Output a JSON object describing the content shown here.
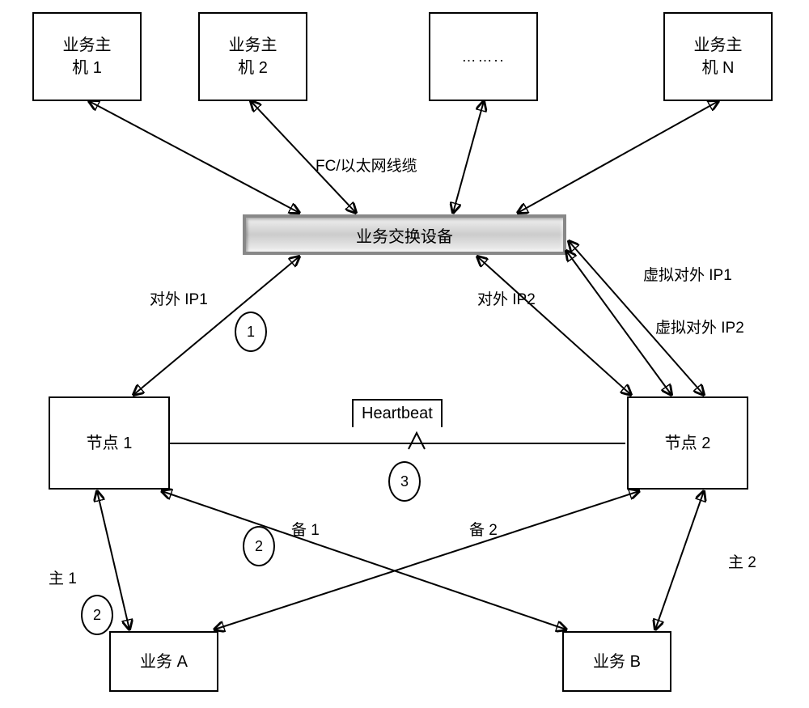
{
  "hosts": {
    "host1": "业务主\n机 1",
    "host2": "业务主\n机 2",
    "hostN": "业务主\n机 N",
    "dots": "…….."
  },
  "cable": "FC/以太网线缆",
  "switch": "业务交换设备",
  "ip": {
    "ext1": "对外 IP1",
    "ext2": "对外 IP2",
    "vext1": "虚拟对外 IP1",
    "vext2": "虚拟对外 IP2"
  },
  "nodes": {
    "n1": "节点 1",
    "n2": "节点 2"
  },
  "heartbeat": "Heartbeat",
  "links": {
    "primary1": "主 1",
    "primary2": "主 2",
    "backup1": "备 1",
    "backup2": "备 2"
  },
  "services": {
    "a": "业务 A",
    "b": "业务 B"
  },
  "markers": {
    "m1": "1",
    "m2a": "2",
    "m2b": "2",
    "m3": "3"
  }
}
